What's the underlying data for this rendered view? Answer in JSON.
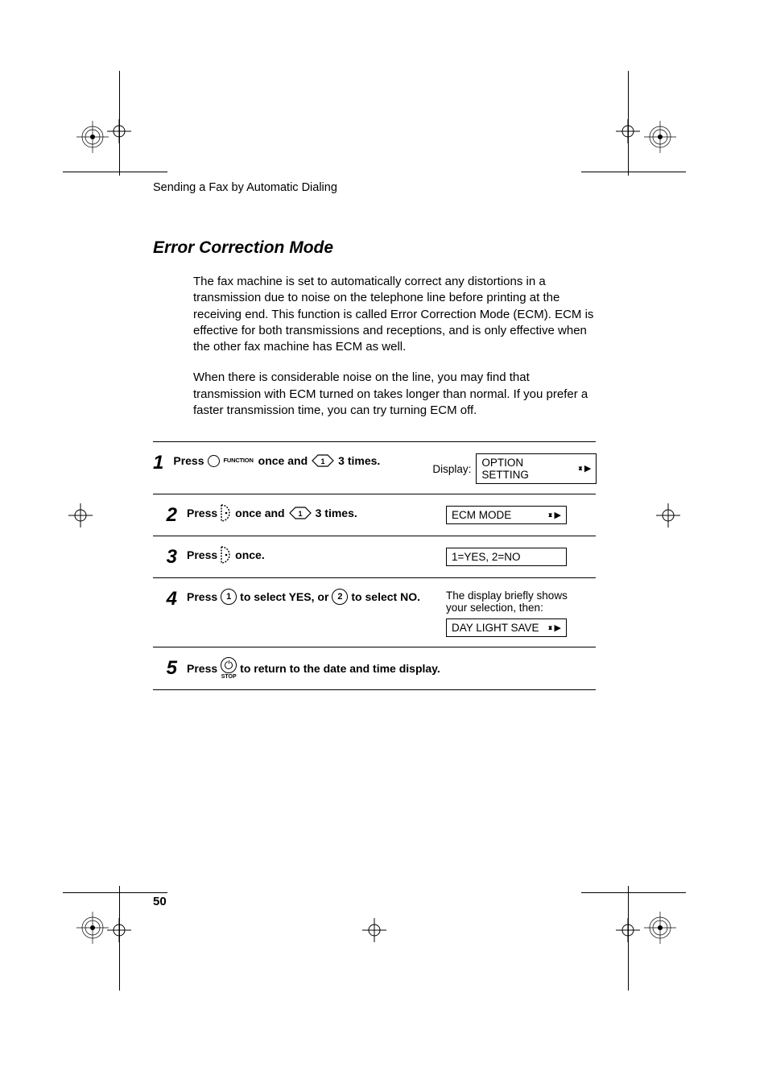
{
  "running_header": "Sending a Fax by Automatic Dialing",
  "section_title": "Error Correction Mode",
  "paragraphs": [
    "The fax machine is set to automatically correct any distortions in a transmission due to noise on the telephone line before printing at the receiving end. This function is called Error Correction Mode (ECM). ECM is effective for both transmissions and receptions, and is only effective when the other fax machine has ECM as well.",
    "When there is considerable noise on the line, you may find that transmission with ECM turned on takes longer than normal. If you prefer a faster transmission time, you can try turning ECM off."
  ],
  "display_prefix": "Display:",
  "steps": [
    {
      "num": "1",
      "press": "Press",
      "function_label": "FUNCTION",
      "mid1": "once and",
      "diamond_label": "1",
      "mid2": "3 times.",
      "display_box": "OPTION SETTING",
      "box_arrows": "updown-right"
    },
    {
      "num": "2",
      "press": "Press",
      "mid1": "once and",
      "diamond_label": "1",
      "mid2": "3 times.",
      "display_box": "ECM MODE",
      "box_arrows": "updown-right"
    },
    {
      "num": "3",
      "press": "Press",
      "mid1": "once.",
      "display_box": "1=YES, 2=NO",
      "box_arrows": "none"
    },
    {
      "num": "4",
      "press": "Press",
      "key1": "1",
      "mid1": "to select YES, or",
      "key2": "2",
      "mid2": "to select NO.",
      "aux_text": "The display briefly shows your selection, then:",
      "display_box": "DAY LIGHT SAVE",
      "box_arrows": "updown-right"
    },
    {
      "num": "5",
      "press": "Press",
      "stop_label": "STOP",
      "mid1": "to return to the date and time display."
    }
  ],
  "page_number": "50"
}
